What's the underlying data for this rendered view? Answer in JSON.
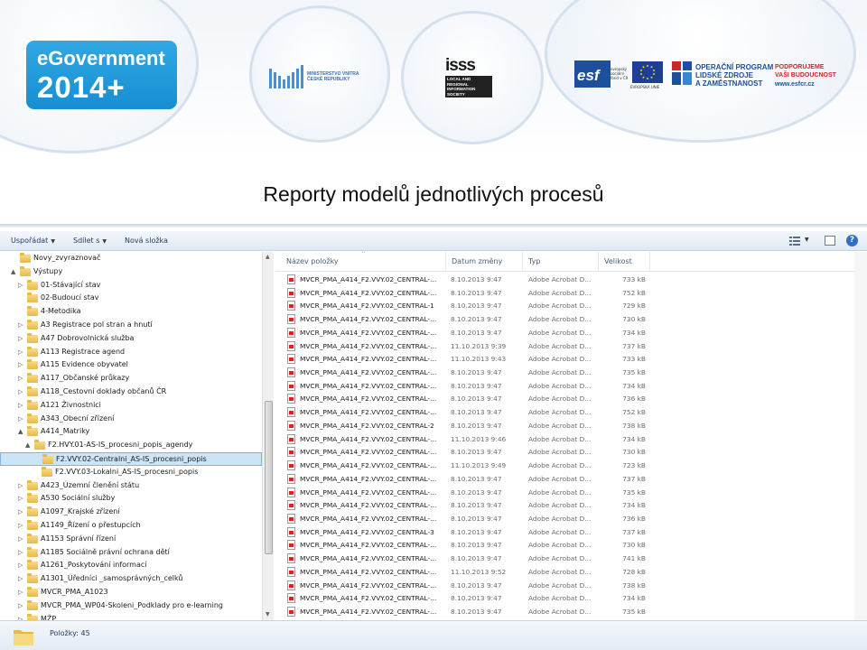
{
  "header": {
    "egov_logo": {
      "name": "eGovernment",
      "year": "2014+",
      "color": "#1a96d8"
    },
    "mv_logo": {
      "text": "MINISTERSTVO VNITRA\nČESKÉ REPUBLIKY"
    },
    "isss_logo": {
      "mark": "isss",
      "caption": "LOCAL AND REGIONAL INFORMATION SOCIETY"
    },
    "esf_logo": {
      "mark": "esf",
      "small_text": "evropský\nsociální\nfond v ČR",
      "eu_caption": "EVROPSKÁ UNIE"
    },
    "op_logo": {
      "text": "OPERAČNÍ PROGRAM\nLIDSKÉ ZDROJE\nA ZAMĚSTNANOST"
    },
    "support": {
      "text": "PODPORUJEME\nVAŠI BUDOUCNOST",
      "url": "www.esfcr.cz"
    }
  },
  "title": "Reporty modelů jednotlivých procesů",
  "toolbar": {
    "organize": "Uspořádat",
    "share": "Sdílet s",
    "new_folder": "Nová složka",
    "help": "?"
  },
  "nav_tree": [
    {
      "label": "Novy_zvyraznovač",
      "level": 1,
      "arrow": ""
    },
    {
      "label": "Výstupy",
      "level": 1,
      "arrow": "▲"
    },
    {
      "label": "01-Stávající stav",
      "level": 2,
      "arrow": "▷"
    },
    {
      "label": "02-Budoucí stav",
      "level": 2,
      "arrow": ""
    },
    {
      "label": "4-Metodika",
      "level": 2,
      "arrow": ""
    },
    {
      "label": "A3 Registrace pol stran a hnutí",
      "level": 2,
      "arrow": "▷"
    },
    {
      "label": "A47 Dobrovolnická služba",
      "level": 2,
      "arrow": "▷"
    },
    {
      "label": "A113 Registrace agend",
      "level": 2,
      "arrow": "▷"
    },
    {
      "label": "A115 Evidence obyvatel",
      "level": 2,
      "arrow": "▷"
    },
    {
      "label": "A117_Občanské průkazy",
      "level": 2,
      "arrow": "▷"
    },
    {
      "label": "A118_Cestovní doklady občanů ČR",
      "level": 2,
      "arrow": "▷"
    },
    {
      "label": "A121 Živnostnici",
      "level": 2,
      "arrow": "▷"
    },
    {
      "label": "A343_Obecní zřízení",
      "level": 2,
      "arrow": "▷"
    },
    {
      "label": "A414_Matriky",
      "level": 2,
      "arrow": "▲"
    },
    {
      "label": "F2.HVY.01-AS-IS_procesni_popis_agendy",
      "level": 3,
      "arrow": "▲"
    },
    {
      "label": "F2.VVY.02-Centralni_AS-IS_procesni_popis",
      "level": 4,
      "arrow": "",
      "selected": true
    },
    {
      "label": "F2.VVY.03-Lokalni_AS-IS_procesni_popis",
      "level": 4,
      "arrow": ""
    },
    {
      "label": "A423_Územní členění státu",
      "level": 2,
      "arrow": "▷"
    },
    {
      "label": "A530 Sociální služby",
      "level": 2,
      "arrow": "▷"
    },
    {
      "label": "A1097_Krajské zřízení",
      "level": 2,
      "arrow": "▷"
    },
    {
      "label": "A1149_Řízení o přestupcích",
      "level": 2,
      "arrow": "▷"
    },
    {
      "label": "A1153 Správní řízení",
      "level": 2,
      "arrow": "▷"
    },
    {
      "label": "A1185 Sociálně právní ochrana dětí",
      "level": 2,
      "arrow": "▷"
    },
    {
      "label": "A1261_Poskytování informací",
      "level": 2,
      "arrow": "▷"
    },
    {
      "label": "A1301_Úředníci _samosprávných_celků",
      "level": 2,
      "arrow": "▷"
    },
    {
      "label": "MVCR_PMA_A1023",
      "level": 2,
      "arrow": "▷"
    },
    {
      "label": "MVCR_PMA_WP04-Skoleni_Podklady pro e-learning",
      "level": 2,
      "arrow": "▷"
    },
    {
      "label": "MŽP",
      "level": 2,
      "arrow": "▷"
    }
  ],
  "columns": {
    "name": "Název položky",
    "date": "Datum změny",
    "type": "Typ",
    "size": "Velikost"
  },
  "files": [
    {
      "name": "MVCR_PMA_A414_F2.VVY.02_CENTRAL-...",
      "date": "8.10.2013 9:47",
      "type": "Adobe Acrobat D...",
      "size": "733 kB"
    },
    {
      "name": "MVCR_PMA_A414_F2.VVY.02_CENTRAL-...",
      "date": "8.10.2013 9:47",
      "type": "Adobe Acrobat D...",
      "size": "752 kB"
    },
    {
      "name": "MVCR_PMA_A414_F2.VVY.02_CENTRAL-1",
      "date": "8.10.2013 9:47",
      "type": "Adobe Acrobat D...",
      "size": "729 kB"
    },
    {
      "name": "MVCR_PMA_A414_F2.VVY.02_CENTRAL-...",
      "date": "8.10.2013 9:47",
      "type": "Adobe Acrobat D...",
      "size": "730 kB"
    },
    {
      "name": "MVCR_PMA_A414_F2.VVY.02_CENTRAL-...",
      "date": "8.10.2013 9:47",
      "type": "Adobe Acrobat D...",
      "size": "734 kB"
    },
    {
      "name": "MVCR_PMA_A414_F2.VVY.02_CENTRAL-...",
      "date": "11.10.2013 9:39",
      "type": "Adobe Acrobat D...",
      "size": "737 kB"
    },
    {
      "name": "MVCR_PMA_A414_F2.VVY.02_CENTRAL-...",
      "date": "11.10.2013 9:43",
      "type": "Adobe Acrobat D...",
      "size": "733 kB"
    },
    {
      "name": "MVCR_PMA_A414_F2.VVY.02_CENTRAL-...",
      "date": "8.10.2013 9:47",
      "type": "Adobe Acrobat D...",
      "size": "735 kB"
    },
    {
      "name": "MVCR_PMA_A414_F2.VVY.02_CENTRAL-...",
      "date": "8.10.2013 9:47",
      "type": "Adobe Acrobat D...",
      "size": "734 kB"
    },
    {
      "name": "MVCR_PMA_A414_F2.VVY.02_CENTRAL-...",
      "date": "8.10.2013 9:47",
      "type": "Adobe Acrobat D...",
      "size": "736 kB"
    },
    {
      "name": "MVCR_PMA_A414_F2.VVY.02_CENTRAL-...",
      "date": "8.10.2013 9:47",
      "type": "Adobe Acrobat D...",
      "size": "752 kB"
    },
    {
      "name": "MVCR_PMA_A414_F2.VVY.02_CENTRAL-2",
      "date": "8.10.2013 9:47",
      "type": "Adobe Acrobat D...",
      "size": "738 kB"
    },
    {
      "name": "MVCR_PMA_A414_F2.VVY.02_CENTRAL-...",
      "date": "11.10.2013 9:46",
      "type": "Adobe Acrobat D...",
      "size": "734 kB"
    },
    {
      "name": "MVCR_PMA_A414_F2.VVY.02_CENTRAL-...",
      "date": "8.10.2013 9:47",
      "type": "Adobe Acrobat D...",
      "size": "730 kB"
    },
    {
      "name": "MVCR_PMA_A414_F2.VVY.02_CENTRAL-...",
      "date": "11.10.2013 9:49",
      "type": "Adobe Acrobat D...",
      "size": "723 kB"
    },
    {
      "name": "MVCR_PMA_A414_F2.VVY.02_CENTRAL-...",
      "date": "8.10.2013 9:47",
      "type": "Adobe Acrobat D...",
      "size": "737 kB"
    },
    {
      "name": "MVCR_PMA_A414_F2.VVY.02_CENTRAL-...",
      "date": "8.10.2013 9:47",
      "type": "Adobe Acrobat D...",
      "size": "735 kB"
    },
    {
      "name": "MVCR_PMA_A414_F2.VVY.02_CENTRAL-...",
      "date": "8.10.2013 9:47",
      "type": "Adobe Acrobat D...",
      "size": "734 kB"
    },
    {
      "name": "MVCR_PMA_A414_F2.VVY.02_CENTRAL-...",
      "date": "8.10.2013 9:47",
      "type": "Adobe Acrobat D...",
      "size": "736 kB"
    },
    {
      "name": "MVCR_PMA_A414_F2.VVY.02_CENTRAL-3",
      "date": "8.10.2013 9:47",
      "type": "Adobe Acrobat D...",
      "size": "737 kB"
    },
    {
      "name": "MVCR_PMA_A414_F2.VVY.02_CENTRAL-...",
      "date": "8.10.2013 9:47",
      "type": "Adobe Acrobat D...",
      "size": "730 kB"
    },
    {
      "name": "MVCR_PMA_A414_F2.VVY.02_CENTRAL-...",
      "date": "8.10.2013 9:47",
      "type": "Adobe Acrobat D...",
      "size": "741 kB"
    },
    {
      "name": "MVCR_PMA_A414_F2.VVY.02_CENTRAL-...",
      "date": "11.10.2013 9:52",
      "type": "Adobe Acrobat D...",
      "size": "728 kB"
    },
    {
      "name": "MVCR_PMA_A414_F2.VVY.02_CENTRAL-...",
      "date": "8.10.2013 9:47",
      "type": "Adobe Acrobat D...",
      "size": "738 kB"
    },
    {
      "name": "MVCR_PMA_A414_F2.VVY.02_CENTRAL-...",
      "date": "8.10.2013 9:47",
      "type": "Adobe Acrobat D...",
      "size": "734 kB"
    },
    {
      "name": "MVCR_PMA_A414_F2.VVY.02_CENTRAL-...",
      "date": "8.10.2013 9:47",
      "type": "Adobe Acrobat D...",
      "size": "735 kB"
    }
  ],
  "status": {
    "count": "Položky: 45"
  }
}
